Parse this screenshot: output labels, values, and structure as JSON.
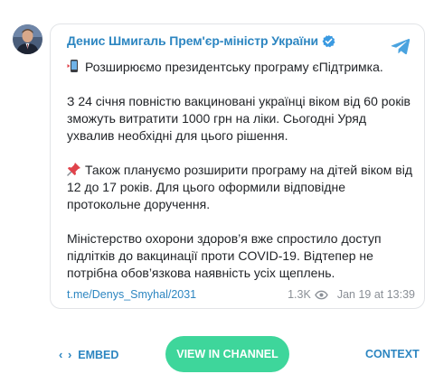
{
  "post": {
    "author": "Денис Шмигаль Прем'єр-міністр України",
    "verified_icon": "verified-badge-icon",
    "source_icon": "telegram-icon",
    "avatar_icon": "author-avatar",
    "paragraphs": [
      {
        "emoji": "mobile-phone-icon",
        "text": "Розширюємо президентську програму єПідтримка."
      },
      {
        "emoji": "",
        "text": "З 24 січня повністю вакциновані українці віком від 60 років зможуть витратити 1000 грн на ліки. Сьогодні Уряд ухвалив необхідні для цього рішення."
      },
      {
        "emoji": "pushpin-icon",
        "text": "Також плануємо розширити програму на дітей віком від 12 до 17 років. Для цього оформили відповідне протокольне доручення."
      },
      {
        "emoji": "",
        "text": "Міністерство охорони здоров’я вже спростило доступ підлітків до вакцинації проти COVID-19. Відтепер не потрібна обов’язкова наявність усіх щеплень."
      }
    ],
    "link": "t.me/Denys_Smyhal/2031",
    "views": "1.3K",
    "date": "Jan 19 at 13:39"
  },
  "actions": {
    "embed_label": "EMBED",
    "embed_icon": "‹ ›",
    "view_channel_label": "VIEW IN CHANNEL",
    "context_label": "CONTEXT"
  },
  "colors": {
    "link": "#2d86c1",
    "button": "#3ed69b",
    "muted": "#8a8f96"
  }
}
